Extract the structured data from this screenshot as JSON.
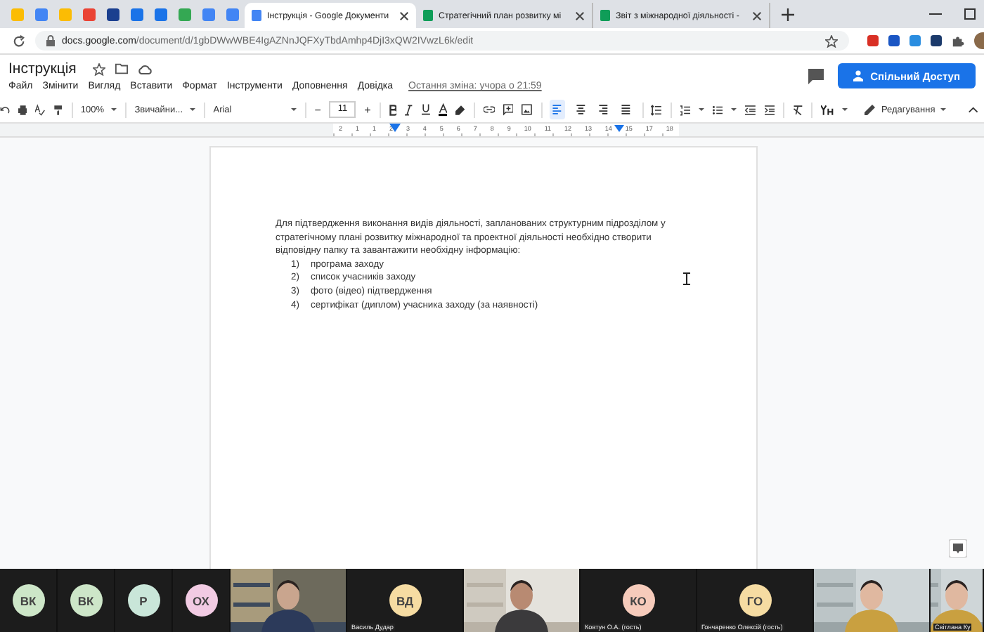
{
  "browser": {
    "tabs": [
      {
        "title": "Інструкція - Google Документи",
        "selected": true
      },
      {
        "title": "Стратегічний план розвитку мі",
        "selected": false
      },
      {
        "title": "Звіт з міжнародної діяльності -",
        "selected": false
      }
    ],
    "url_host": "docs.google.com",
    "url_path": "/document/d/1gbDWwWBE4IgAZNnJQFXyTbdAmhp4DjI3xQW2IVwzL6k/edit"
  },
  "docs": {
    "title": "Інструкція",
    "menu": [
      "Файл",
      "Змінити",
      "Вигляд",
      "Вставити",
      "Формат",
      "Інструменти",
      "Доповнення",
      "Довідка"
    ],
    "last_edit": "Остання зміна: учора о 21:59",
    "share_button": "Спільний Доступ"
  },
  "toolbar": {
    "zoom": "100%",
    "style": "Звичайни...",
    "font": "Arial",
    "size_minus": "−",
    "size": "11",
    "size_plus": "+",
    "alignment": [
      {
        "selected": true
      },
      {
        "selected": false
      },
      {
        "selected": false
      },
      {
        "selected": false
      }
    ],
    "mode": "Редагування"
  },
  "document": {
    "paragraph": "Для підтвердження виконання видів діяльності, запланованих структурним підрозділом у стратегічному плані розвитку міжнародної та проектної діяльності необхідно створити відповідну папку та завантажити необхідну  інформацію:",
    "list": [
      {
        "number": "1)",
        "text": "програма заходу"
      },
      {
        "number": "2)",
        "text": "список учасників заходу"
      },
      {
        "number": "3)",
        "text": "фото (відео) підтвердження"
      },
      {
        "number": "4)",
        "text": "сертифікат (диплом) учасника заходу (за наявності)"
      }
    ]
  },
  "ruler": {
    "numbers": [
      "2",
      "1",
      "1",
      "2",
      "3",
      "4",
      "5",
      "6",
      "7",
      "8",
      "9",
      "10",
      "11",
      "12",
      "13",
      "14",
      "15",
      "17",
      "18"
    ]
  },
  "participants": [
    {
      "kind": "avatar",
      "initials": "ВК",
      "color": "#cde6c8"
    },
    {
      "kind": "avatar",
      "initials": "ВК",
      "color": "#cde6c8"
    },
    {
      "kind": "avatar",
      "initials": "Р",
      "color": "#c9e6d9"
    },
    {
      "kind": "avatar",
      "initials": "ОХ",
      "color": "#f2cbe3"
    },
    {
      "kind": "video"
    },
    {
      "kind": "avatar",
      "initials": "ВД",
      "color": "#f6dca2",
      "name": "Василь Дудар"
    },
    {
      "kind": "video"
    },
    {
      "kind": "avatar",
      "initials": "КО",
      "color": "#f6cbbb",
      "name": "Ковтун О.А. (гость)"
    },
    {
      "kind": "avatar",
      "initials": "ГО",
      "color": "#f6dca2",
      "name": "Гончаренко Олексій (гость)"
    },
    {
      "kind": "video"
    },
    {
      "kind": "video",
      "name": "Світлана Ку"
    }
  ]
}
